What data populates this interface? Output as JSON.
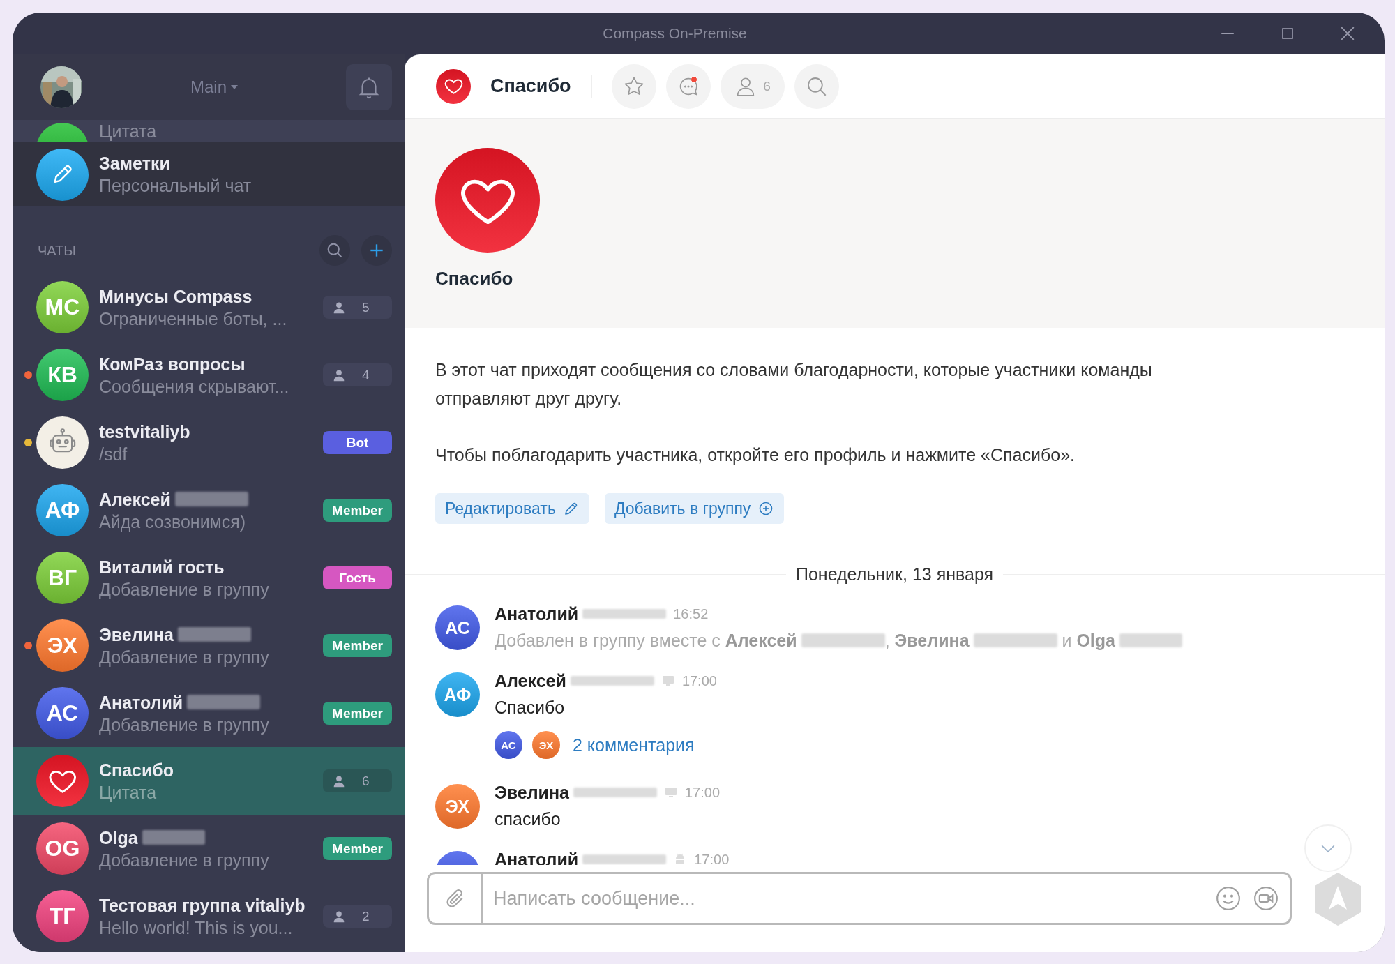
{
  "window": {
    "title": "Compass On-Premise"
  },
  "sidebar": {
    "workspace": "Main",
    "notifications_unread": false,
    "partial_row": {
      "preview": "Цитата",
      "avatar": {
        "kind": "initials",
        "color": "#2fb33d"
      }
    },
    "pinned": {
      "name": "Заметки",
      "preview": "Персональный чат",
      "avatar": {
        "kind": "pencil",
        "color": "#2aa3e0"
      }
    },
    "section_title": "ЧАТЫ",
    "chats": [
      {
        "name": "Минусы Compass",
        "surname_hidden": false,
        "preview": "Ограниченные боты, ...",
        "avatar": {
          "kind": "initials",
          "text": "МС",
          "color": "#7cc242"
        },
        "badge": {
          "kind": "members",
          "text": "5"
        },
        "selected": false
      },
      {
        "name": "КомРаз вопросы",
        "surname_hidden": false,
        "preview": "Сообщения скрывают...",
        "unread_dot": {
          "color": "#f0643c"
        },
        "avatar": {
          "kind": "initials",
          "text": "КВ",
          "color": "#2db35a"
        },
        "badge": {
          "kind": "members",
          "text": "4"
        },
        "selected": false
      },
      {
        "name": "testvitaliyb",
        "surname_hidden": false,
        "preview": "/sdf",
        "unread_dot": {
          "color": "#e6b83a"
        },
        "avatar": {
          "kind": "bot",
          "color": "#f3efe6"
        },
        "badge": {
          "kind": "role",
          "text": "Bot",
          "color": "#5a5fe0"
        },
        "selected": false
      },
      {
        "name": "Алексей",
        "surname_hidden": true,
        "preview": "Айда созвонимся)",
        "avatar": {
          "kind": "initials",
          "text": "АФ",
          "color": "#2a9fdc"
        },
        "badge": {
          "kind": "role",
          "text": "Member",
          "color": "#2e9c7d"
        },
        "selected": false
      },
      {
        "name": "Виталий гость",
        "surname_hidden": false,
        "preview": "Добавление в группу",
        "avatar": {
          "kind": "initials",
          "text": "ВГ",
          "color": "#7cc242"
        },
        "badge": {
          "kind": "role",
          "text": "Гость",
          "color": "#d657c1"
        },
        "selected": false
      },
      {
        "name": "Эвелина",
        "surname_hidden": true,
        "preview": "Добавление в группу",
        "unread_dot": {
          "color": "#f0643c"
        },
        "avatar": {
          "kind": "initials",
          "text": "ЭХ",
          "color": "#f07a3a"
        },
        "badge": {
          "kind": "role",
          "text": "Member",
          "color": "#2e9c7d"
        },
        "selected": false
      },
      {
        "name": "Анатолий",
        "surname_hidden": true,
        "preview": "Добавление в группу",
        "avatar": {
          "kind": "initials",
          "text": "АС",
          "color": "#4a5fd8"
        },
        "badge": {
          "kind": "role",
          "text": "Member",
          "color": "#2e9c7d"
        },
        "selected": false
      },
      {
        "name": "Спасибо",
        "surname_hidden": false,
        "preview": "Цитата",
        "avatar": {
          "kind": "heart",
          "color": "#e0202e"
        },
        "badge": {
          "kind": "members",
          "text": "6"
        },
        "selected": true
      },
      {
        "name": "Olga",
        "surname_hidden": true,
        "preview": "Добавление в группу",
        "avatar": {
          "kind": "initials",
          "text": "OG",
          "color": "#e0506a"
        },
        "badge": {
          "kind": "role",
          "text": "Member",
          "color": "#2e9c7d"
        },
        "selected": false
      },
      {
        "name": "Тестовая группа vitaliyb",
        "surname_hidden": false,
        "preview": "Hello world! This is you...",
        "avatar": {
          "kind": "initials",
          "text": "ТГ",
          "color": "#e04a7e"
        },
        "badge": {
          "kind": "members",
          "text": "2"
        },
        "selected": false
      }
    ]
  },
  "chat": {
    "title": "Спасибо",
    "avatar": {
      "kind": "heart",
      "color": "#e0202e"
    },
    "comments_unread": true,
    "member_count": "6",
    "intro": {
      "title": "Спасибо",
      "avatar": {
        "kind": "heart",
        "color": "#e0202e"
      },
      "paragraphs": [
        "В этот чат приходят сообщения со словами благодарности, которые участники команды отправляют друг другу.",
        "Чтобы поблагодарить участника, откройте его профиль и нажмите «Спасибо»."
      ],
      "actions": [
        {
          "label": "Редактировать",
          "kind": "edit"
        },
        {
          "label": "Добавить в группу",
          "kind": "add"
        }
      ]
    },
    "date_divider": "Понедельник, 13 января",
    "messages": [
      {
        "author": "Анатолий",
        "surname_hidden": true,
        "avatar": {
          "kind": "initials",
          "text": "АС",
          "color": "#4a5fd8"
        },
        "time": "16:52",
        "kind": "system",
        "parts": [
          {
            "kind": "text",
            "text": "Добавлен в группу вместе с "
          },
          {
            "kind": "person",
            "text": "Алексей"
          },
          {
            "kind": "text",
            "text": ", "
          },
          {
            "kind": "person",
            "text": "Эвелина"
          },
          {
            "kind": "text",
            "text": " и "
          },
          {
            "kind": "person",
            "text": "Olga"
          }
        ]
      },
      {
        "author": "Алексей",
        "surname_hidden": true,
        "avatar": {
          "kind": "initials",
          "text": "АФ",
          "color": "#2a9fdc"
        },
        "client": {
          "kind": "desktop"
        },
        "time": "17:00",
        "kind": "text",
        "text": "Спасибо",
        "thread": {
          "avatars": [
            {
              "kind": "initials",
              "text": "АС",
              "color": "#4a5fd8"
            },
            {
              "kind": "initials",
              "text": "ЭХ",
              "color": "#f07a3a"
            }
          ],
          "link": "2 комментария"
        }
      },
      {
        "author": "Эвелина",
        "surname_hidden": true,
        "avatar": {
          "kind": "initials",
          "text": "ЭХ",
          "color": "#f07a3a"
        },
        "client": {
          "kind": "desktop"
        },
        "time": "17:00",
        "kind": "text",
        "text": "спасибо"
      },
      {
        "author": "Анатолий",
        "surname_hidden": true,
        "avatar": {
          "kind": "initials",
          "color": "#4a5fd8"
        },
        "client": {
          "kind": "mobile"
        },
        "time": "17:00",
        "kind": "text"
      }
    ],
    "composer": {
      "placeholder": "Написать сообщение..."
    },
    "send_disabled": true
  }
}
